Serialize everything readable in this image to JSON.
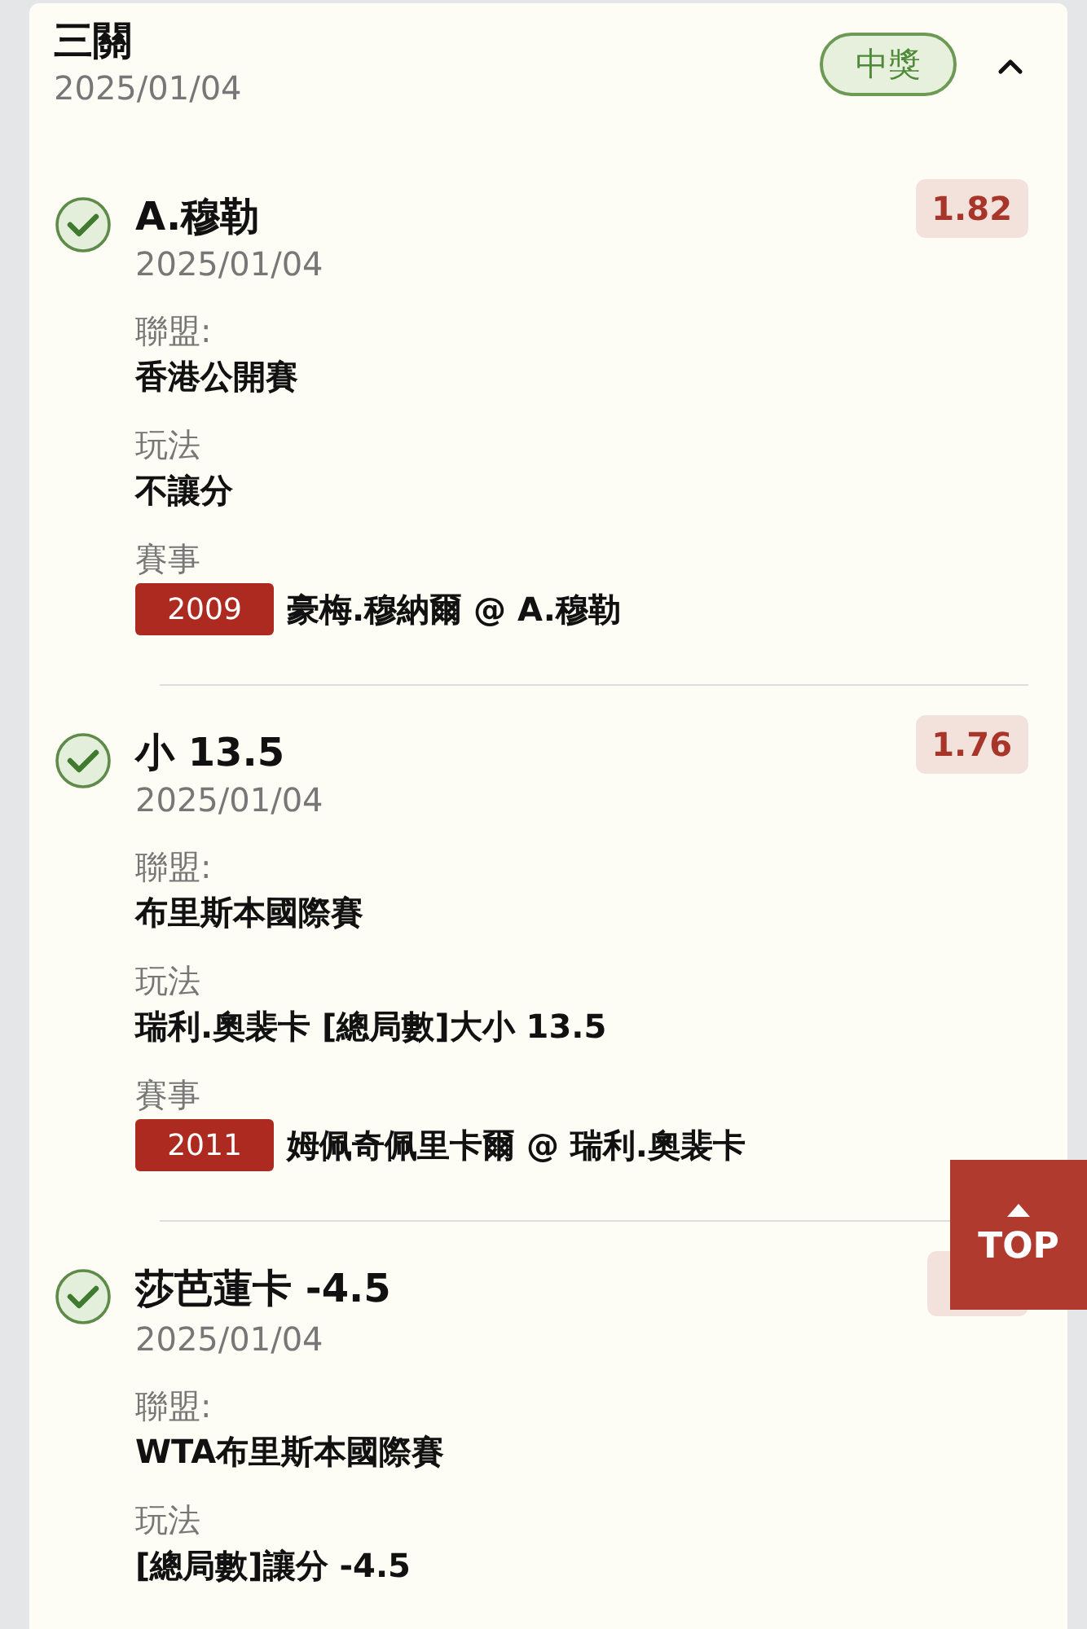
{
  "bet": {
    "title": "三關",
    "date": "2025/01/04",
    "status": "中獎",
    "expanded": true
  },
  "legs": [
    {
      "won": true,
      "selection": "A.穆勒",
      "date": "2025/01/04",
      "odds": "1.82",
      "fields": [
        {
          "label": "聯盟:",
          "value": "香港公開賽"
        },
        {
          "label": "玩法",
          "value": "不讓分"
        },
        {
          "label": "賽事",
          "code": "2009",
          "value": "豪梅.穆納爾 @ A.穆勒"
        }
      ]
    },
    {
      "won": true,
      "selection": "小 13.5",
      "date": "2025/01/04",
      "odds": "1.76",
      "fields": [
        {
          "label": "聯盟:",
          "value": "布里斯本國際賽"
        },
        {
          "label": "玩法",
          "value": "瑞利.奧裴卡 [總局數]大小 13.5"
        },
        {
          "label": "賽事",
          "code": "2011",
          "value": "姆佩奇佩里卡爾 @ 瑞利.奧裴卡"
        }
      ]
    },
    {
      "won": true,
      "selection": "莎芭蓮卡 -4.5",
      "date": "2025/01/04",
      "fields": [
        {
          "label": "聯盟:",
          "value": "WTA布里斯本國際賽"
        },
        {
          "label": "玩法",
          "value": "[總局數]讓分 -4.5"
        }
      ]
    }
  ],
  "top_button": {
    "label": "TOP"
  }
}
